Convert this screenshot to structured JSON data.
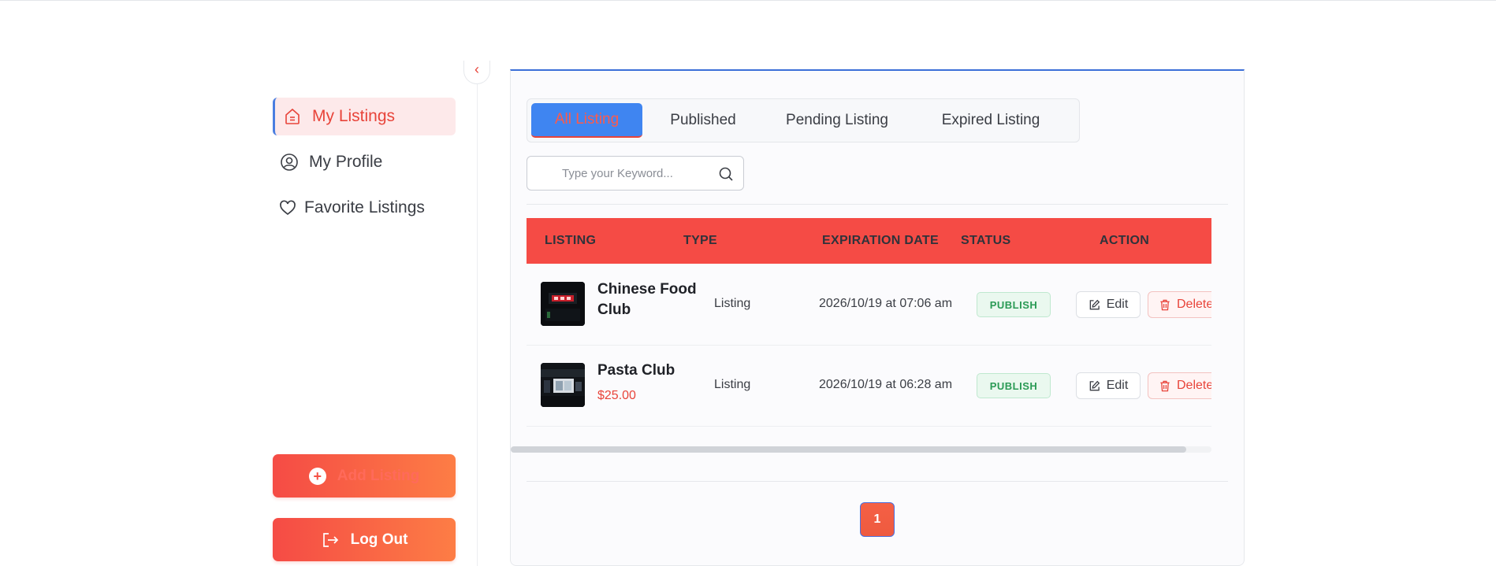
{
  "sidebar": {
    "items": [
      {
        "label": "My Listings",
        "icon": "listing-icon",
        "active": true
      },
      {
        "label": "My Profile",
        "icon": "user-circle-icon",
        "active": false
      },
      {
        "label": "Favorite Listings",
        "icon": "heart-icon",
        "active": false
      }
    ],
    "add_listing_label": "Add Listing",
    "logout_label": "Log Out",
    "collapse_icon": "chevron-left-icon"
  },
  "tabs": [
    {
      "label": "All Listing",
      "active": true
    },
    {
      "label": "Published",
      "active": false
    },
    {
      "label": "Pending Listing",
      "active": false
    },
    {
      "label": "Expired Listing",
      "active": false
    }
  ],
  "search": {
    "placeholder": "Type your Keyword...",
    "value": ""
  },
  "table": {
    "columns": [
      "LISTING",
      "TYPE",
      "EXPIRATION DATE",
      "STATUS",
      "ACTION"
    ],
    "rows": [
      {
        "title": "Chinese Food Club",
        "price": "",
        "type": "Listing",
        "expiration": "2026/10/19 at 07:06 am",
        "status": "PUBLISH",
        "edit": "Edit",
        "delete": "Delete"
      },
      {
        "title": "Pasta Club",
        "price": "$25.00",
        "type": "Listing",
        "expiration": "2026/10/19 at 06:28 am",
        "status": "PUBLISH",
        "edit": "Edit",
        "delete": "Delete"
      }
    ]
  },
  "pagination": {
    "current": "1"
  },
  "colors": {
    "accent": "#f54b45",
    "tab_active": "#3f85f1",
    "status_green": "#2a9a55"
  }
}
